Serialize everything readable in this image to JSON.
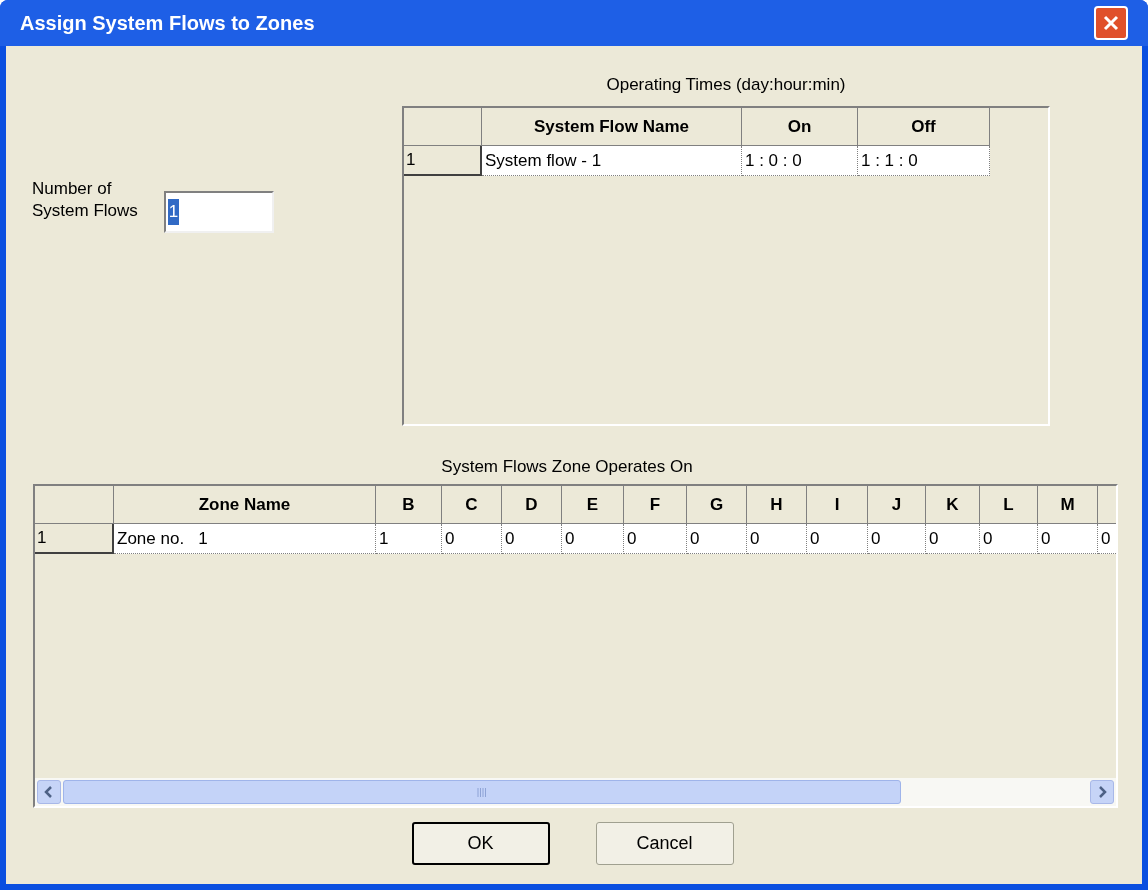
{
  "window": {
    "title": "Assign System Flows to Zones"
  },
  "flow_count": {
    "label": "Number of\nSystem Flows",
    "value": "1",
    "text_selected": true
  },
  "operating_times": {
    "title": "Operating Times (day:hour:min)",
    "columns": [
      "System Flow Name",
      "On",
      "Off"
    ],
    "rows": [
      {
        "index": "1",
        "cells": [
          "System flow - 1",
          "1 : 0 : 0",
          "1 : 1 : 0"
        ]
      }
    ]
  },
  "zone_flows": {
    "title": "System Flows Zone Operates On",
    "columns": [
      "Zone Name",
      "B",
      "C",
      "D",
      "E",
      "F",
      "G",
      "H",
      "I",
      "J",
      "K",
      "L",
      "M"
    ],
    "rows": [
      {
        "index": "1",
        "cells": [
          "Zone no.   1",
          "1",
          "0",
          "0",
          "0",
          "0",
          "0",
          "0",
          "0",
          "0",
          "0",
          "0",
          "0",
          "0"
        ]
      }
    ]
  },
  "buttons": [
    {
      "label": "OK",
      "default": true
    },
    {
      "label": "Cancel",
      "default": false
    }
  ]
}
